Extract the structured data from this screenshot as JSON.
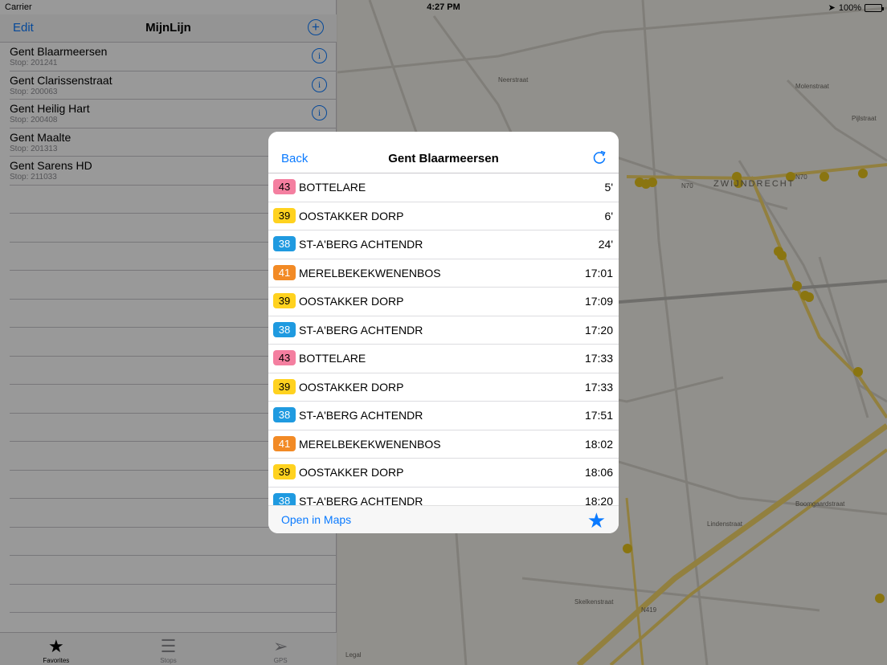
{
  "status": {
    "carrier": "Carrier",
    "time": "4:27 PM",
    "battery": "100%"
  },
  "master": {
    "edit_label": "Edit",
    "title": "MijnLijn",
    "stops": [
      {
        "name": "Gent Blaarmeersen",
        "sub": "Stop: 201241"
      },
      {
        "name": "Gent Clarissenstraat",
        "sub": "Stop: 200063"
      },
      {
        "name": "Gent Heilig Hart",
        "sub": "Stop: 200408"
      },
      {
        "name": "Gent Maalte",
        "sub": "Stop: 201313"
      },
      {
        "name": "Gent Sarens HD",
        "sub": "Stop: 211033"
      }
    ]
  },
  "tabs": [
    {
      "label": "Favorites",
      "icon": "star-icon"
    },
    {
      "label": "Stops",
      "icon": "list-icon"
    },
    {
      "label": "GPS",
      "icon": "location-arrow-icon"
    }
  ],
  "map": {
    "labels": [
      "N70",
      "N70",
      "ZWIJNDRECHT",
      "N419",
      "Legal",
      "Neerstraat",
      "Molenstraat",
      "Pijlstraat",
      "Lindenstraat",
      "Skelkenstraat",
      "Boomgaardstraat"
    ]
  },
  "modal": {
    "back_label": "Back",
    "title": "Gent Blaarmeersen",
    "open_maps_label": "Open in Maps",
    "departures": [
      {
        "line": "43",
        "color": "#f47fa0",
        "destination": "BOTTELARE",
        "time": "5'"
      },
      {
        "line": "39",
        "color": "#ffd21f",
        "destination": "OOSTAKKER DORP",
        "time": "6'"
      },
      {
        "line": "38",
        "color": "#1f9ae0",
        "destination": "ST-A'BERG ACHTENDR",
        "time": "24'"
      },
      {
        "line": "41",
        "color": "#f28a25",
        "destination": "MERELBEKEKWENENBOS",
        "time": "17:01"
      },
      {
        "line": "39",
        "color": "#ffd21f",
        "destination": "OOSTAKKER DORP",
        "time": "17:09"
      },
      {
        "line": "38",
        "color": "#1f9ae0",
        "destination": "ST-A'BERG ACHTENDR",
        "time": "17:20"
      },
      {
        "line": "43",
        "color": "#f47fa0",
        "destination": "BOTTELARE",
        "time": "17:33"
      },
      {
        "line": "39",
        "color": "#ffd21f",
        "destination": "OOSTAKKER DORP",
        "time": "17:33"
      },
      {
        "line": "38",
        "color": "#1f9ae0",
        "destination": "ST-A'BERG ACHTENDR",
        "time": "17:51"
      },
      {
        "line": "41",
        "color": "#f28a25",
        "destination": "MERELBEKEKWENENBOS",
        "time": "18:02"
      },
      {
        "line": "39",
        "color": "#ffd21f",
        "destination": "OOSTAKKER DORP",
        "time": "18:06"
      },
      {
        "line": "38",
        "color": "#1f9ae0",
        "destination": "ST-A'BERG ACHTENDR",
        "time": "18:20"
      }
    ]
  }
}
